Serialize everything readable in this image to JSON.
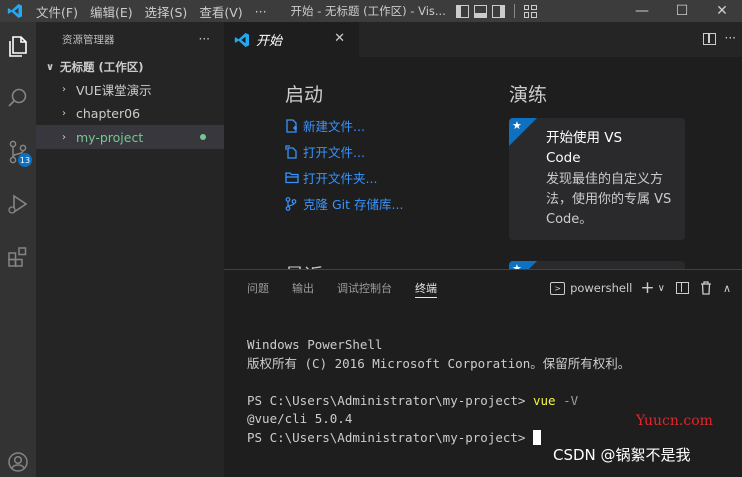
{
  "titlebar": {
    "menu": [
      "文件(F)",
      "编辑(E)",
      "选择(S)",
      "查看(V)",
      "···"
    ],
    "title": "开始 - 无标题 (工作区) - Vis...",
    "controls": [
      "—",
      "☐",
      "✕"
    ]
  },
  "activity": {
    "scm_badge": "13"
  },
  "sidebar": {
    "header": "资源管理器",
    "more": "···",
    "workspace": "无标题 (工作区)",
    "folders": [
      {
        "label": "VUE课堂演示"
      },
      {
        "label": "chapter06"
      },
      {
        "label": "my-project"
      }
    ]
  },
  "editor": {
    "tab_label": "开始",
    "tab_close": "✕",
    "more": "···"
  },
  "welcome": {
    "start_heading": "启动",
    "start_links": [
      "新建文件...",
      "打开文件...",
      "打开文件夹...",
      "克隆 Git 存储库..."
    ],
    "walkthrough_heading": "演练",
    "card_title": "开始使用 VS Code",
    "card_desc": "发现最佳的自定义方法，使用你的专属 VS Code。",
    "recent_heading": "最近"
  },
  "panel": {
    "tabs": [
      "问题",
      "输出",
      "调试控制台",
      "终端"
    ],
    "active_tab": "终端",
    "terminal_name": "powershell"
  },
  "terminal": {
    "line1": "Windows PowerShell",
    "line2": "版权所有 (C) 2016 Microsoft Corporation。保留所有权利。",
    "prompt": "PS C:\\Users\\Administrator\\my-project> ",
    "cmd": "vue",
    "flag": " -V",
    "output": "@vue/cli 5.0.4",
    "prompt2": "PS C:\\Users\\Administrator\\my-project> "
  },
  "watermarks": {
    "site": "Yuucn.com",
    "author": "CSDN @锅絮不是我"
  },
  "colors": {
    "accent": "#0e70c0",
    "link": "#3794ff",
    "git_green": "#73c991",
    "titlebar": "#3c3c3c"
  }
}
